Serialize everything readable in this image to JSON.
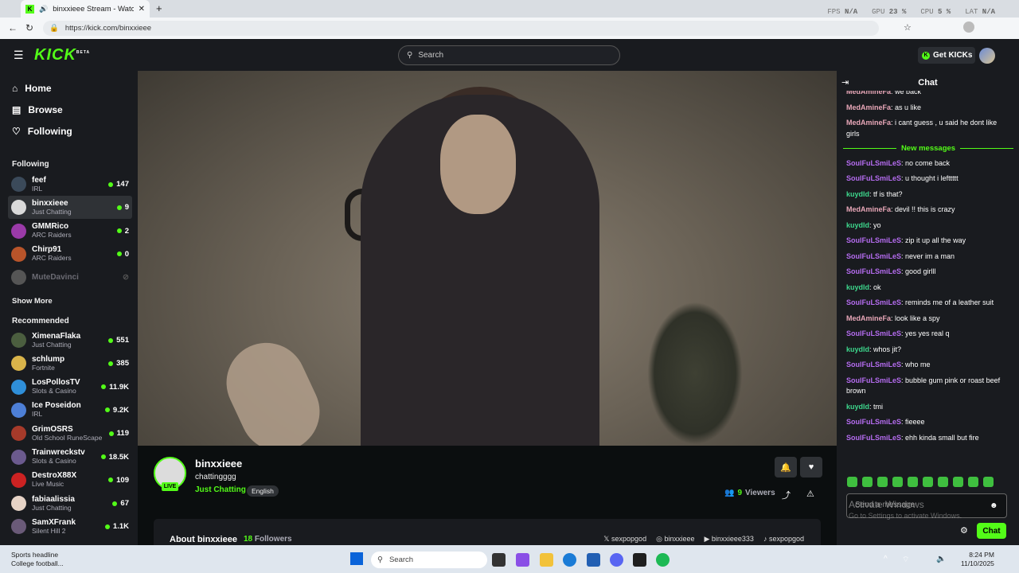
{
  "browser": {
    "tab_title": "binxxieee Stream - Watch Liv",
    "url": "https://kick.com/binxxieee",
    "overlay": {
      "fps_label": "FPS",
      "fps_value": "N/A",
      "gpu_label": "GPU",
      "gpu_value": "23 %",
      "cpu_label": "CPU",
      "cpu_value": "5 %",
      "lat_label": "LAT",
      "lat_value": "N/A"
    }
  },
  "header": {
    "logo": "KICK",
    "logo_badge": "BETA",
    "search_placeholder": "Search",
    "get_kicks": "Get KICKs"
  },
  "sidebar": {
    "nav": [
      {
        "label": "Home",
        "icon": "home-icon"
      },
      {
        "label": "Browse",
        "icon": "browse-icon"
      },
      {
        "label": "Following",
        "icon": "heart-icon"
      }
    ],
    "following_title": "Following",
    "following": [
      {
        "name": "feef",
        "category": "IRL",
        "viewers": "147",
        "color": "#3b4a5a"
      },
      {
        "name": "binxxieee",
        "category": "Just Chatting",
        "viewers": "9",
        "color": "#d9d9d9"
      },
      {
        "name": "GMMRico",
        "category": "ARC Raiders",
        "viewers": "2",
        "color": "#9a3aa8"
      },
      {
        "name": "Chirp91",
        "category": "ARC Raiders",
        "viewers": "0",
        "color": "#b8542a"
      },
      {
        "name": "MuteDavinci",
        "category": "",
        "viewers": "",
        "color": "#555555"
      }
    ],
    "show_more": "Show More",
    "recommended_title": "Recommended",
    "recommended": [
      {
        "name": "XimenaFlaka",
        "category": "Just Chatting",
        "viewers": "551",
        "color": "#4b5e3f"
      },
      {
        "name": "schlump",
        "category": "Fortnite",
        "viewers": "385",
        "color": "#d9b44a"
      },
      {
        "name": "LosPollosTV",
        "category": "Slots & Casino",
        "viewers": "11.9K",
        "color": "#2f8fd9"
      },
      {
        "name": "Ice Poseidon",
        "category": "IRL",
        "viewers": "9.2K",
        "color": "#4d7fd6"
      },
      {
        "name": "GrimOSRS",
        "category": "Old School RuneScape",
        "viewers": "119",
        "color": "#a63a2a"
      },
      {
        "name": "Trainwreckstv",
        "category": "Slots & Casino",
        "viewers": "18.5K",
        "color": "#6b5a8e"
      },
      {
        "name": "DestroX88X",
        "category": "Live Music",
        "viewers": "109",
        "color": "#cc2222"
      },
      {
        "name": "fabiaalissia",
        "category": "Just Chatting",
        "viewers": "67",
        "color": "#e6d3c6"
      },
      {
        "name": "SamXFrank",
        "category": "Silent Hill 2",
        "viewers": "1.1K",
        "color": "#6a5a78"
      }
    ]
  },
  "stream": {
    "live_badge": "LIVE",
    "name": "binxxieee",
    "title": "chattingggg",
    "category": "Just Chatting",
    "language": "English",
    "viewers_count": "9",
    "viewers_label": "Viewers",
    "about": "About binxxieee",
    "followers_count": "18",
    "followers_label": "Followers",
    "socials": [
      "sexpopgod",
      "binxxieee",
      "binxxieee333",
      "sexpopgod"
    ]
  },
  "chat": {
    "title": "Chat",
    "new_messages": "New messages",
    "messages_before": [
      {
        "user": "MedAmineFa",
        "text": "we back",
        "color": "#e8a7b8"
      },
      {
        "user": "MedAmineFa",
        "text": "as u like",
        "color": "#e8a7b8"
      },
      {
        "user": "MedAmineFa",
        "text": "i cant guess , u said he dont like girls",
        "color": "#e8a7b8"
      }
    ],
    "messages_after": [
      {
        "user": "SoulFuLSmiLeS",
        "text": "no come back",
        "color": "#b56cf0"
      },
      {
        "user": "SoulFuLSmiLeS",
        "text": "u thought i lefttttt",
        "color": "#b56cf0"
      },
      {
        "user": "kuydld",
        "text": "tf is that?",
        "color": "#3dd68c"
      },
      {
        "user": "MedAmineFa",
        "text": "devil !! this is crazy",
        "color": "#e8a7b8"
      },
      {
        "user": "kuydld",
        "text": "yo",
        "color": "#3dd68c"
      },
      {
        "user": "SoulFuLSmiLeS",
        "text": "zip it up all the way",
        "color": "#b56cf0"
      },
      {
        "user": "SoulFuLSmiLeS",
        "text": "never im a man",
        "color": "#b56cf0"
      },
      {
        "user": "SoulFuLSmiLeS",
        "text": "good girlll",
        "color": "#b56cf0"
      },
      {
        "user": "kuydld",
        "text": "ok",
        "color": "#3dd68c"
      },
      {
        "user": "SoulFuLSmiLeS",
        "text": "reminds me of a leather suit",
        "color": "#b56cf0"
      },
      {
        "user": "MedAmineFa",
        "text": "look like a spy",
        "color": "#e8a7b8"
      },
      {
        "user": "SoulFuLSmiLeS",
        "text": "yes yes real q",
        "color": "#b56cf0"
      },
      {
        "user": "kuydld",
        "text": "whos jit?",
        "color": "#3dd68c"
      },
      {
        "user": "SoulFuLSmiLeS",
        "text": "who me",
        "color": "#b56cf0"
      },
      {
        "user": "SoulFuLSmiLeS",
        "text": "bubble gum pink or roast beef brown",
        "color": "#b56cf0"
      },
      {
        "user": "kuydld",
        "text": "tmi",
        "color": "#3dd68c"
      },
      {
        "user": "SoulFuLSmiLeS",
        "text": "fieeee",
        "color": "#b56cf0"
      },
      {
        "user": "SoulFuLSmiLeS",
        "text": "ehh kinda small but fire",
        "color": "#b56cf0"
      }
    ],
    "input_placeholder": "Send a message",
    "watermark_line1": "Activate Windows",
    "watermark_line2": "Go to Settings to activate Windows.",
    "send_label": "Chat"
  },
  "taskbar": {
    "news_line1": "Sports headline",
    "news_line2": "College football...",
    "search_placeholder": "Search",
    "time": "8:24 PM",
    "date": "11/10/2025"
  },
  "colors": {
    "accent": "#53fc18",
    "panel": "#191b1f",
    "bg": "#0b0e0f"
  }
}
